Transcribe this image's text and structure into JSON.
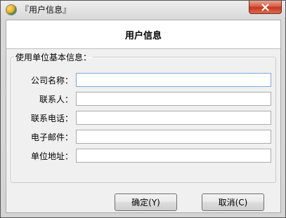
{
  "window": {
    "title": "『用户信息』",
    "icon": "app-logo-icon"
  },
  "header": {
    "title": "用户信息"
  },
  "group": {
    "legend": "使用单位基本信息：",
    "fields": [
      {
        "label": "公司名称：",
        "value": ""
      },
      {
        "label": "联系人：",
        "value": ""
      },
      {
        "label": "联系电话：",
        "value": ""
      },
      {
        "label": "电子邮件：",
        "value": ""
      },
      {
        "label": "单位地址：",
        "value": ""
      }
    ]
  },
  "buttons": {
    "ok": "确定(Y)",
    "cancel": "取消(C)"
  },
  "colors": {
    "close_button": "#c8341c",
    "focus_border": "#7ca7d6"
  }
}
